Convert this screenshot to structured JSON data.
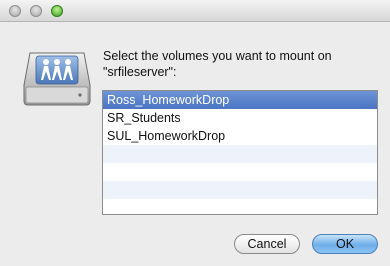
{
  "dialog": {
    "prompt": "Select the volumes you want to mount on \"srfileserver\":"
  },
  "volumes": [
    {
      "label": "Ross_HomeworkDrop",
      "selected": true
    },
    {
      "label": "SR_Students",
      "selected": false
    },
    {
      "label": "SUL_HomeworkDrop",
      "selected": false
    }
  ],
  "buttons": {
    "cancel": "Cancel",
    "ok": "OK"
  },
  "colors": {
    "selection": "#5580cc",
    "default_button": "#6faee9",
    "alt_row": "#eef3fb"
  },
  "icons": {
    "server": "network-server-icon"
  }
}
